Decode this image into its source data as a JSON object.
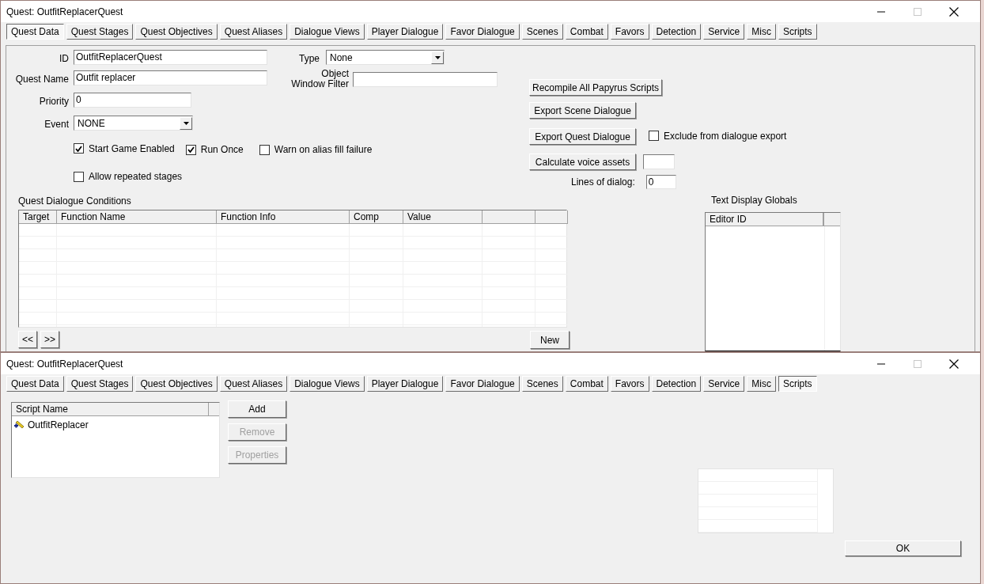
{
  "quest_window": {
    "title": "Quest: OutfitReplacerQuest",
    "tabs": [
      {
        "label": "Quest Data",
        "selected": true
      },
      {
        "label": "Quest Stages",
        "selected": false
      },
      {
        "label": "Quest Objectives",
        "selected": false
      },
      {
        "label": "Quest Aliases",
        "selected": false
      },
      {
        "label": "Dialogue Views",
        "selected": false
      },
      {
        "label": "Player Dialogue",
        "selected": false
      },
      {
        "label": "Favor Dialogue",
        "selected": false
      },
      {
        "label": "Scenes",
        "selected": false
      },
      {
        "label": "Combat",
        "selected": false
      },
      {
        "label": "Favors",
        "selected": false
      },
      {
        "label": "Detection",
        "selected": false
      },
      {
        "label": "Service",
        "selected": false
      },
      {
        "label": "Misc",
        "selected": false
      },
      {
        "label": "Scripts",
        "selected": false
      }
    ],
    "id": {
      "label": "ID",
      "value": "OutfitReplacerQuest"
    },
    "quest_name": {
      "label": "Quest Name",
      "value": "Outfit replacer"
    },
    "priority": {
      "label": "Priority",
      "value": "0"
    },
    "event": {
      "label": "Event",
      "value": "NONE"
    },
    "type": {
      "label": "Type",
      "value": "None"
    },
    "object_window_filter": {
      "label": "Object Window Filter"
    },
    "checkboxes": [
      {
        "label": "Start Game Enabled",
        "checked": true
      },
      {
        "label": "Run Once",
        "checked": true
      },
      {
        "label": "Warn on alias fill failure",
        "checked": false
      },
      {
        "label": "Allow repeated stages",
        "checked": false
      }
    ],
    "conditions": {
      "title": "Quest Dialogue Conditions",
      "columns": [
        "Target",
        "Function Name",
        "Function Info",
        "Comp",
        "Value"
      ]
    },
    "nav_buttons": [
      "<<",
      ">>"
    ],
    "new_button": "New",
    "recompile_button": "Recompile All Papyrus Scripts",
    "export_scene_button": "Export Scene Dialogue",
    "export_quest_button": "Export Quest Dialogue",
    "exclude_checkbox": {
      "label": "Exclude from dialogue export",
      "checked": false
    },
    "calculate_button": "Calculate voice assets",
    "lines_of_dialog": {
      "label": "Lines of dialog:",
      "value": "0"
    },
    "globals": {
      "title": "Text Display Globals",
      "columns": [
        "Editor ID"
      ]
    }
  },
  "scripts_window": {
    "title": "Quest: OutfitReplacerQuest",
    "tabs": [
      {
        "label": "Quest Data",
        "selected": false
      },
      {
        "label": "Quest Stages",
        "selected": false
      },
      {
        "label": "Quest Objectives",
        "selected": false
      },
      {
        "label": "Quest Aliases",
        "selected": false
      },
      {
        "label": "Dialogue Views",
        "selected": false
      },
      {
        "label": "Player Dialogue",
        "selected": false
      },
      {
        "label": "Favor Dialogue",
        "selected": false
      },
      {
        "label": "Scenes",
        "selected": false
      },
      {
        "label": "Combat",
        "selected": false
      },
      {
        "label": "Favors",
        "selected": false
      },
      {
        "label": "Detection",
        "selected": false
      },
      {
        "label": "Service",
        "selected": false
      },
      {
        "label": "Misc",
        "selected": false
      },
      {
        "label": "Scripts",
        "selected": true
      }
    ],
    "script_list": {
      "column": "Script Name",
      "items": [
        "OutfitReplacer"
      ]
    },
    "buttons": [
      {
        "label": "Add",
        "disabled": false
      },
      {
        "label": "Remove",
        "disabled": true
      },
      {
        "label": "Properties",
        "disabled": true
      }
    ],
    "ok_button": "OK"
  }
}
